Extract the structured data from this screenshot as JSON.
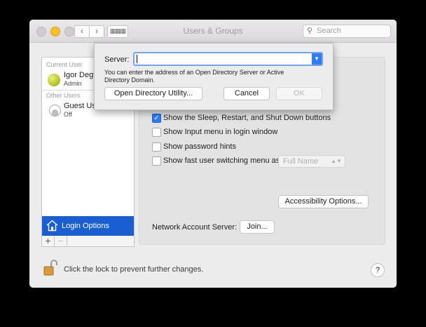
{
  "window": {
    "title": "Users & Groups"
  },
  "toolbar": {
    "back": "‹",
    "forward": "›",
    "grid": "▦▦▦",
    "search_placeholder": "Search"
  },
  "sidebar": {
    "current_user_header": "Current User",
    "current_user": {
      "name": "Igor Degt",
      "role": "Admin"
    },
    "other_users_header": "Other Users",
    "guest_user": {
      "name": "Guest Us",
      "role": "Off"
    },
    "login_options_label": "Login Options",
    "add_label": "+",
    "remove_label": "−"
  },
  "options": {
    "items": [
      {
        "label": "Show the Sleep, Restart, and Shut Down buttons",
        "checked": true
      },
      {
        "label": "Show Input menu in login window",
        "checked": false
      },
      {
        "label": "Show password hints",
        "checked": false
      },
      {
        "label": "Show fast user switching menu as",
        "checked": false
      }
    ],
    "fast_switch_value": "Full Name",
    "accessibility_button": "Accessibility Options...",
    "network_label": "Network Account Server:",
    "join_button": "Join..."
  },
  "footer": {
    "lock_text": "Click the lock to prevent further changes.",
    "help": "?"
  },
  "sheet": {
    "server_label": "Server:",
    "server_value": "",
    "help_text": "You can enter the address of an Open Directory Server or Active Directory Domain.",
    "od_utility_button": "Open Directory Utility...",
    "cancel_button": "Cancel",
    "ok_button": "OK"
  },
  "colors": {
    "selection": "#1a5fd1",
    "accent": "#2f7cf6",
    "minimize": "#f6c02b"
  }
}
